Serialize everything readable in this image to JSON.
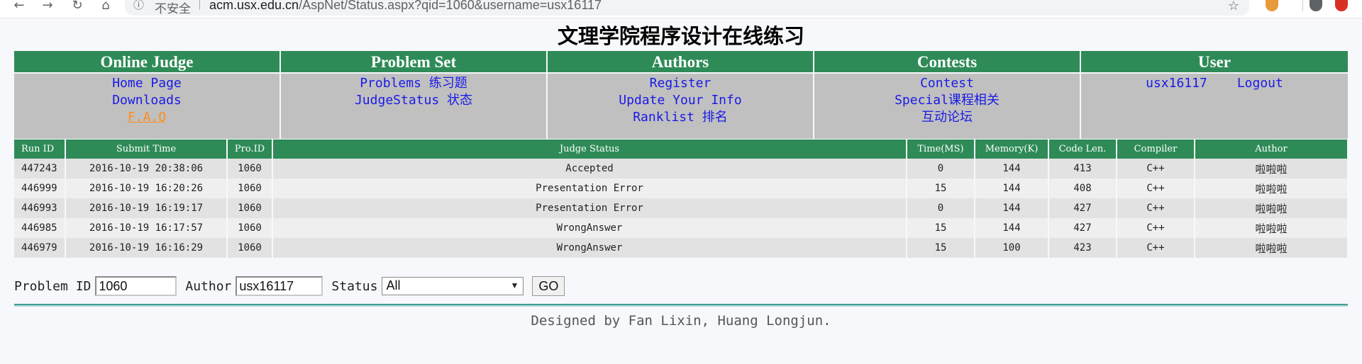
{
  "browser": {
    "security_label": "不安全",
    "url_host": "acm.usx.edu.cn",
    "url_path": "/AspNet/Status.aspx?qid=1060&username=usx16117"
  },
  "site_title": "文理学院程序设计在线练习",
  "menu": {
    "online_judge": {
      "title": "Online Judge",
      "links": [
        "Home Page",
        "Downloads",
        "F.A.Q"
      ]
    },
    "problem_set": {
      "title": "Problem Set",
      "links": [
        "Problems 练习题",
        "JudgeStatus 状态"
      ]
    },
    "authors": {
      "title": "Authors",
      "links": [
        "Register",
        "Update Your Info",
        "Ranklist 排名"
      ]
    },
    "contests": {
      "title": "Contests",
      "links": [
        "Contest",
        "Special课程相关",
        "互动论坛"
      ]
    },
    "user": {
      "title": "User",
      "username": "usx16117",
      "logout": "Logout"
    }
  },
  "status_table": {
    "headers": [
      "Run ID",
      "Submit Time",
      "Pro.ID",
      "Judge Status",
      "Time(MS)",
      "Memory(K)",
      "Code Len.",
      "Compiler",
      "Author"
    ],
    "rows": [
      {
        "run_id": "447243",
        "submit_time": "2016-10-19 20:38:06",
        "pro_id": "1060",
        "status": "Accepted",
        "time": "0",
        "memory": "144",
        "code_len": "413",
        "compiler": "C++",
        "author": "啦啦啦"
      },
      {
        "run_id": "446999",
        "submit_time": "2016-10-19 16:20:26",
        "pro_id": "1060",
        "status": "Presentation Error",
        "time": "15",
        "memory": "144",
        "code_len": "408",
        "compiler": "C++",
        "author": "啦啦啦"
      },
      {
        "run_id": "446993",
        "submit_time": "2016-10-19 16:19:17",
        "pro_id": "1060",
        "status": "Presentation Error",
        "time": "0",
        "memory": "144",
        "code_len": "427",
        "compiler": "C++",
        "author": "啦啦啦"
      },
      {
        "run_id": "446985",
        "submit_time": "2016-10-19 16:17:57",
        "pro_id": "1060",
        "status": "WrongAnswer",
        "time": "15",
        "memory": "144",
        "code_len": "427",
        "compiler": "C++",
        "author": "啦啦啦"
      },
      {
        "run_id": "446979",
        "submit_time": "2016-10-19 16:16:29",
        "pro_id": "1060",
        "status": "WrongAnswer",
        "time": "15",
        "memory": "100",
        "code_len": "423",
        "compiler": "C++",
        "author": "啦啦啦"
      }
    ]
  },
  "filter": {
    "problem_id_label": "Problem ID",
    "problem_id_value": "1060",
    "author_label": "Author",
    "author_value": "usx16117",
    "status_label": "Status",
    "status_value": "All",
    "go_label": "GO"
  },
  "footer": "Designed by Fan Lixin, Huang Longjun.",
  "colors": {
    "header_green": "#2e8b57",
    "accepted": "#e61a1a",
    "presentation_error": "#ff9a1a",
    "wrong_answer": "#1a8a1a",
    "link": "#1a1ae6"
  }
}
